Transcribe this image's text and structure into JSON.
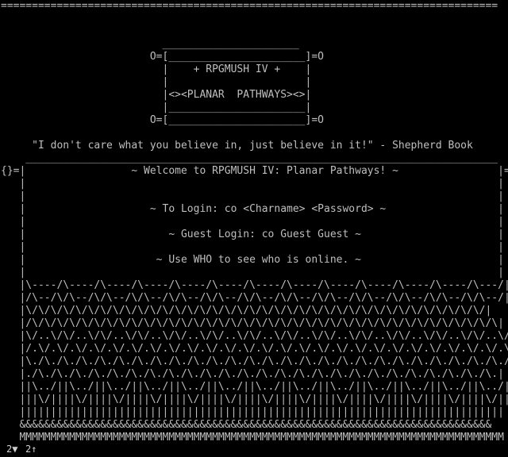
{
  "terminal": {
    "lines": [
      "================================================================================",
      "",
      "",
      "                          ______________________",
      "                        O=[______________________]=O",
      "                          |    + RPGMUSH IV +    |",
      "                          |                      |",
      "                          |<><PLANAR  PATHWAYS><>|",
      "                          |______________________|",
      "                        O=[______________________]=O",
      "",
      "     \"I don't care what you believe in, just believe in it!\" - Shepherd Book",
      "    ____________________________________________________________________________",
      "{}=|                 ~ Welcome to RPGMUSH IV: Planar Pathways! ~                |={}",
      "   |                                                                            |",
      "   |                                                                            |",
      "   |                    ~ To Login: co <Charname> <Password> ~                  |",
      "   |                                                                            |",
      "   |                       ~ Guest Login: co Guest Guest ~                      |",
      "   |                                                                            |",
      "   |                     ~ Use WHO to see who is online. ~                      |",
      "   |                                                                            |",
      "   |\\----/\\----/\\----/\\----/\\----/\\----/\\----/\\----/\\----/\\----/\\----/\\----/\\---/|",
      "   |/\\--/\\/\\--/\\/\\--/\\/\\--/\\/\\--/\\/\\--/\\/\\--/\\/\\--/\\/\\--/\\/\\--/\\/\\--/\\/\\--/\\/\\--/|",
      "   |\\/\\/\\/\\/\\/\\/\\/\\/\\/\\/\\/\\/\\/\\/\\/\\/\\/\\/\\/\\/\\/\\/\\/\\/\\/\\/\\/\\/\\/\\/\\/\\/\\/\\/\\/\\/\\/|",
      "   |/\\/\\/\\/\\/\\/\\/\\/\\/\\/\\/\\/\\/\\/\\/\\/\\/\\/\\/\\/\\/\\/\\/\\/\\/\\/\\/\\/\\/\\/\\/\\/\\/\\/\\/\\/\\/\\/\\|",
      "   |\\/..\\/\\/..\\/\\/..\\/\\/..\\/\\/..\\/\\/..\\/\\/..\\/\\/..\\/\\/..\\/\\/..\\/\\/..\\/\\/..\\/\\/..\\/|",
      "   |/.\\/.\\/.\\/.\\/.\\/.\\/.\\/.\\/.\\/.\\/.\\/.\\/.\\/.\\/.\\/.\\/.\\/.\\/.\\/.\\/.\\/.\\/.\\/.\\/.\\/.\\|",
      "   |\\./\\./\\./\\./\\./\\./\\./\\./\\./\\./\\./\\./\\./\\./\\./\\./\\./\\./\\./\\./\\./\\./\\./\\./\\./\\./|",
      "   |./\\./\\./\\./\\./\\./\\./\\./\\./\\./\\./\\./\\./\\./\\./\\./\\./\\./\\./\\./\\./\\./\\./\\./\\./\\.|",
      "   ||\\../||\\../||\\../||\\../||\\../||\\../||\\../||\\../||\\../||\\../||\\../||\\../||\\../|",
      "   |||\\/||||\\/||||\\/||||\\/||||\\/||||\\/||||\\/||||\\/||||\\/||||\\/||||\\/||||\\/||||\\/||",
      "   ||||||||||||||||||||||||||||||||||||||||||||||||||||||||||||||||||||||||||||||",
      "   &&&&&&&&&&&&&&&&&&&&&&&&&&&&&&&&&&&&&&&&&&&&&&&&&&&&&&&&&&&&&&&&&&&&&&&&&&&&",
      "   MMMMMMMMMMMMMMMMMMMMMMMMMMMMMMMMMMMMMMMMMMMMMMMMMMMMMMMMMMMMMMMMMMMMMMMMMMMMMM",
      "",
      "================================================================================"
    ]
  },
  "status_bar": {
    "left": "2▼",
    "right": "2↑"
  }
}
